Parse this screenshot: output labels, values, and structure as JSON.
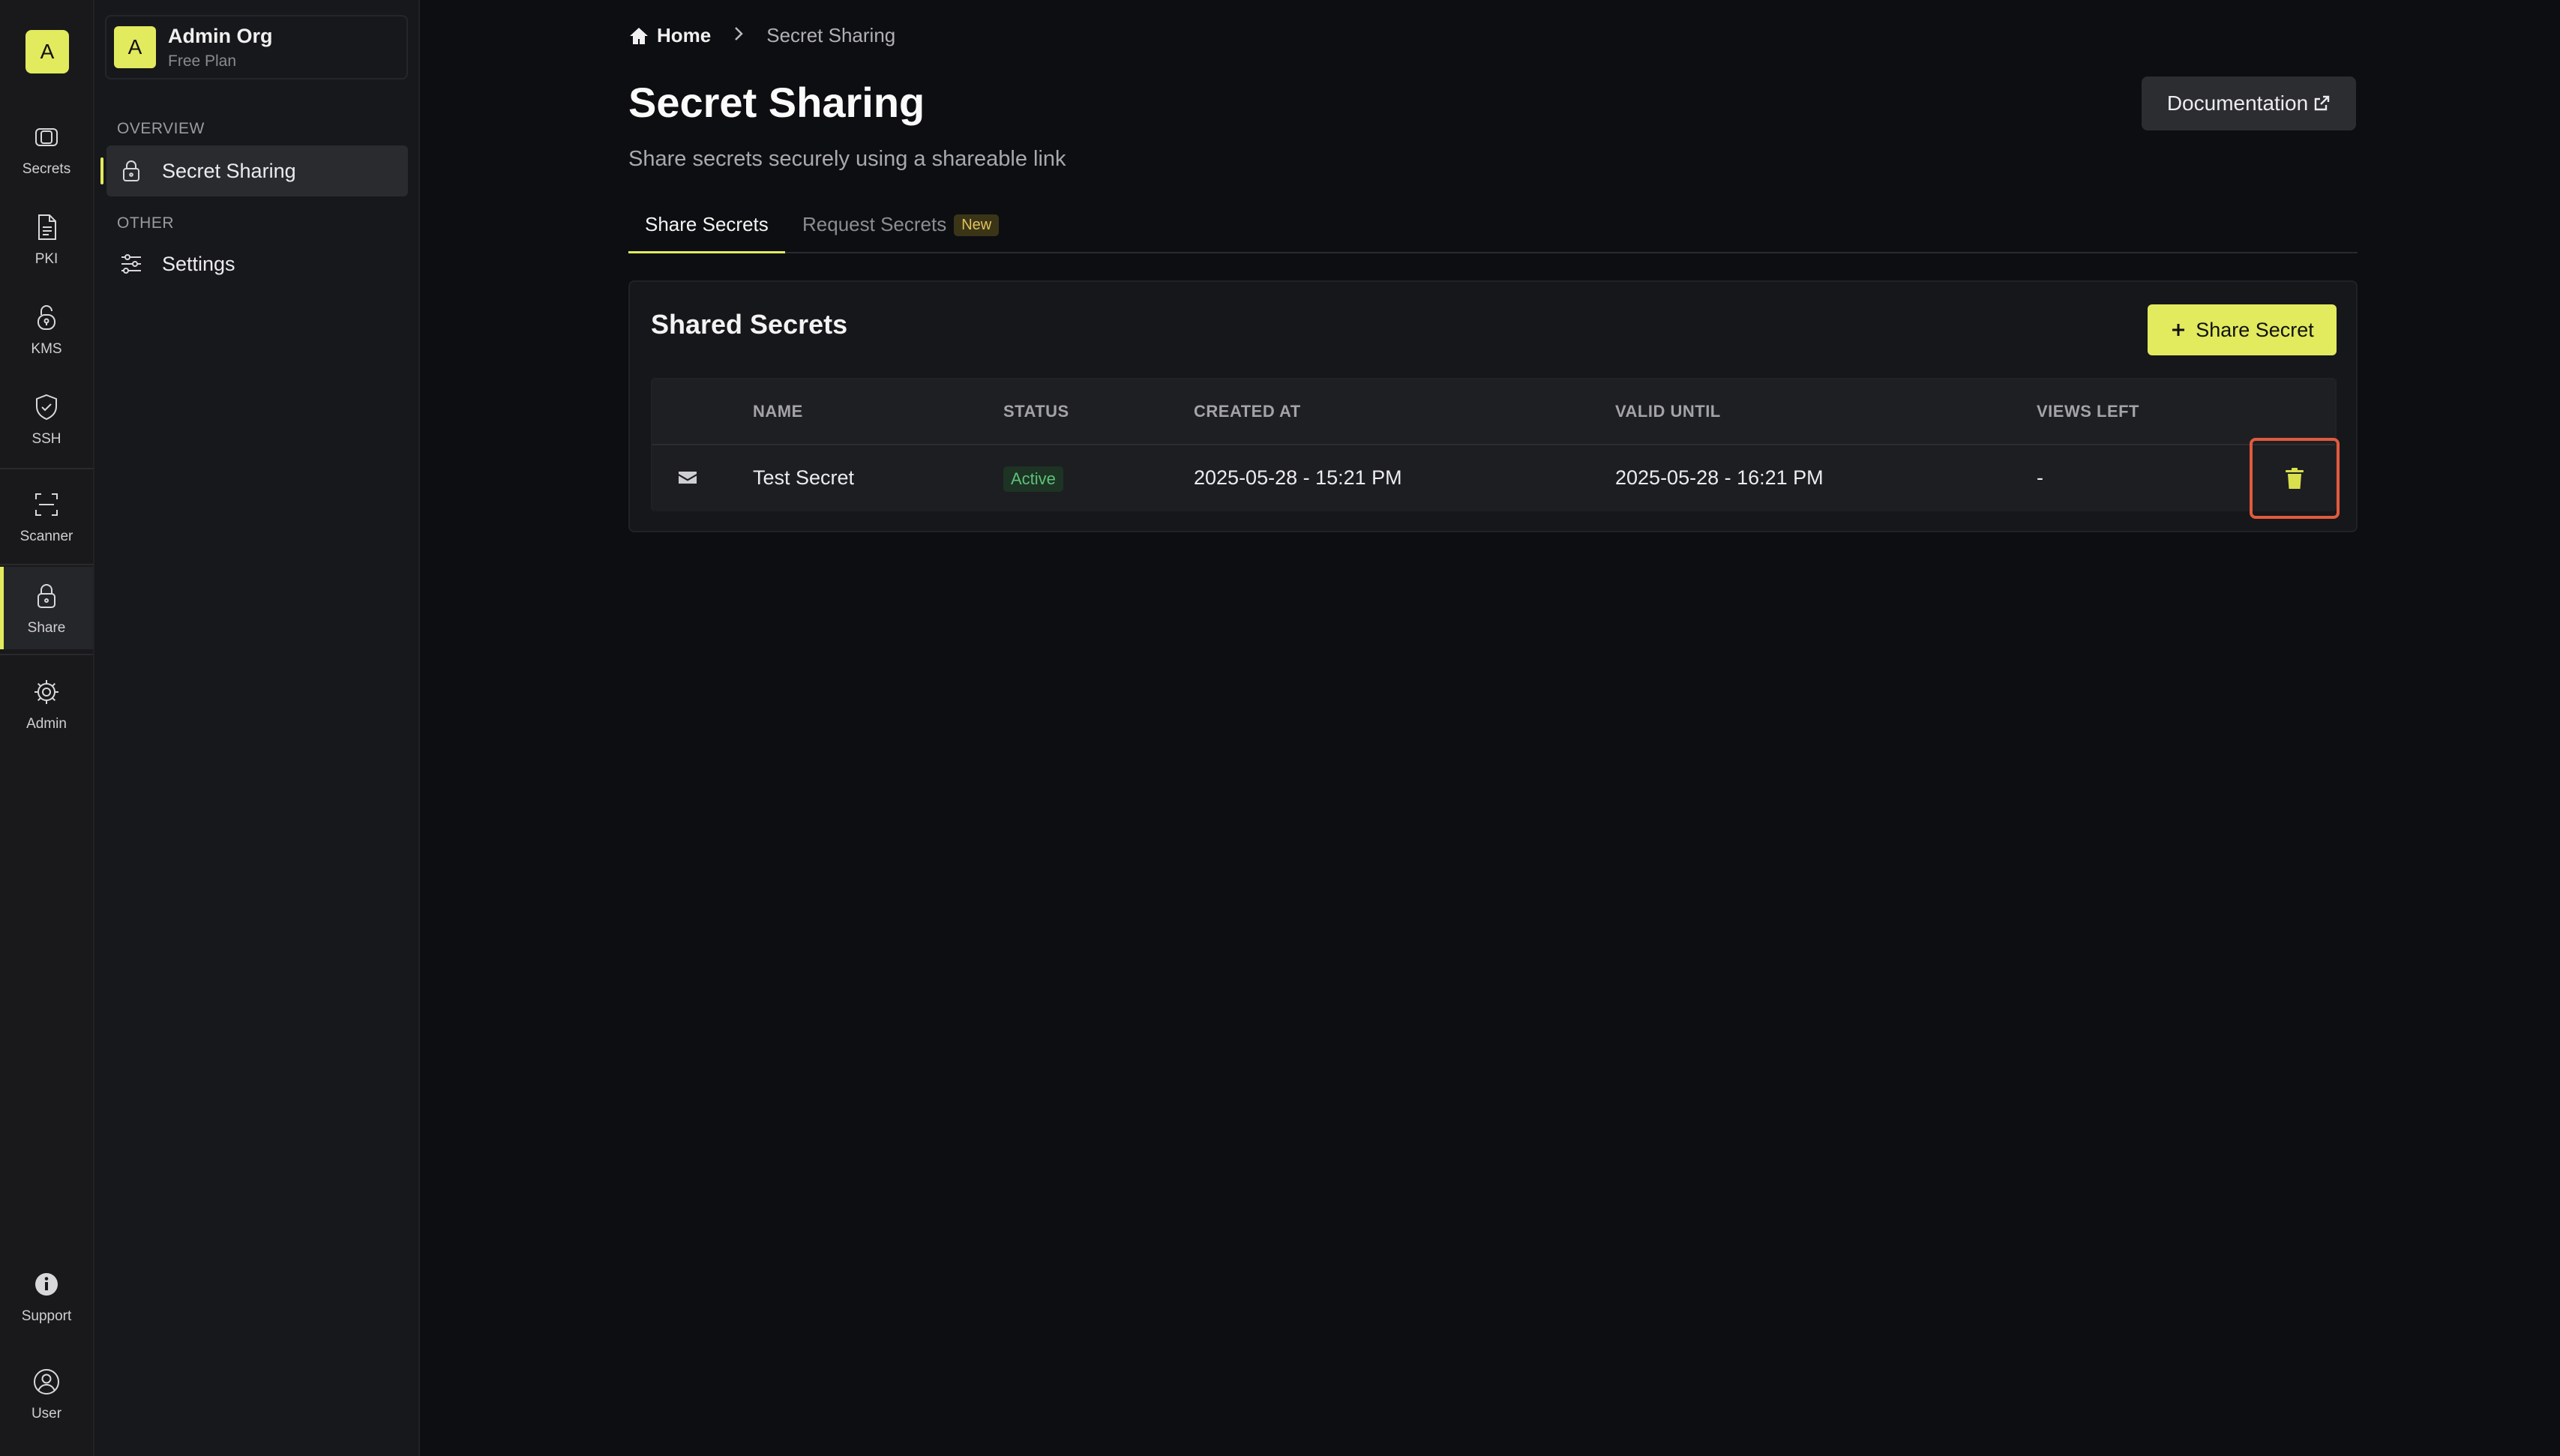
{
  "colors": {
    "accent": "#e2ea5e",
    "background": "#0d0e12",
    "active_status": "#5dc27a",
    "highlight": "#e15a3d"
  },
  "rail": {
    "logo": "A",
    "items": [
      {
        "label": "Secrets",
        "icon": "vault-icon"
      },
      {
        "label": "PKI",
        "icon": "document-icon"
      },
      {
        "label": "KMS",
        "icon": "lock-key-icon"
      },
      {
        "label": "SSH",
        "icon": "shield-check-icon"
      },
      {
        "label": "Scanner",
        "icon": "scan-icon"
      },
      {
        "label": "Share",
        "icon": "lock-icon"
      },
      {
        "label": "Admin",
        "icon": "gear-icon"
      },
      {
        "label": "Support",
        "icon": "info-icon"
      },
      {
        "label": "User",
        "icon": "user-icon"
      }
    ]
  },
  "org": {
    "avatar": "A",
    "name": "Admin Org",
    "plan": "Free Plan"
  },
  "sidebar": {
    "overview_label": "OVERVIEW",
    "other_label": "OTHER",
    "items": [
      {
        "label": "Secret Sharing",
        "icon": "lock-icon"
      },
      {
        "label": "Settings",
        "icon": "sliders-icon"
      }
    ]
  },
  "breadcrumb": {
    "home": "Home",
    "current": "Secret Sharing"
  },
  "page": {
    "title": "Secret Sharing",
    "subtitle": "Share secrets securely using a shareable link",
    "doc_button": "Documentation"
  },
  "tabs": {
    "share": "Share Secrets",
    "request": "Request Secrets",
    "request_badge": "New"
  },
  "card": {
    "title": "Shared Secrets",
    "share_button": "Share Secret",
    "columns": [
      "NAME",
      "STATUS",
      "CREATED AT",
      "VALID UNTIL",
      "VIEWS LEFT"
    ],
    "rows": [
      {
        "name": "Test Secret",
        "status": "Active",
        "created_at": "2025-05-28 - 15:21 PM",
        "valid_until": "2025-05-28 - 16:21 PM",
        "views_left": "-"
      }
    ]
  }
}
